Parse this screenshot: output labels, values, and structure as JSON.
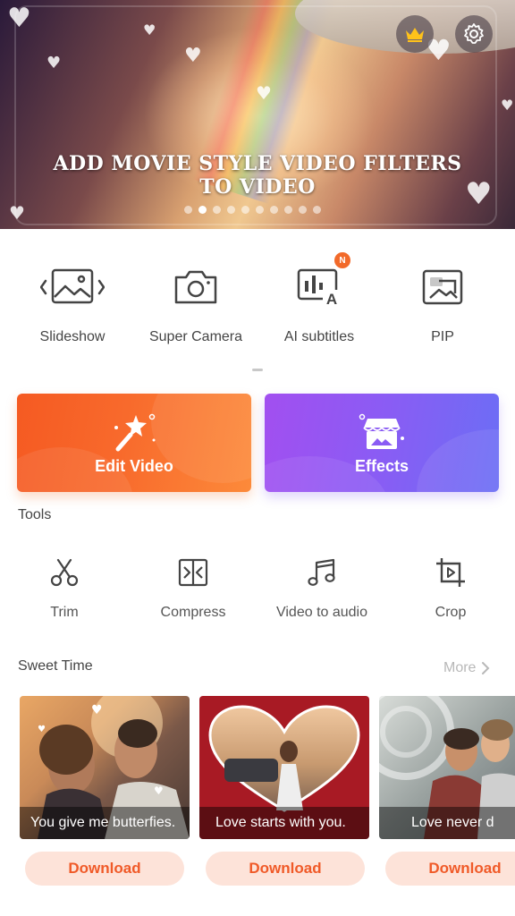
{
  "banner": {
    "title_line1": "ADD MOVIE STYLE VIDEO FILTERS",
    "title_line2": "TO VIDEO",
    "dots": 10,
    "active_dot": 1
  },
  "features": [
    {
      "label": "Slideshow",
      "icon": "slideshow-icon"
    },
    {
      "label": "Super Camera",
      "icon": "camera-icon"
    },
    {
      "label": "AI subtitles",
      "icon": "ai-subtitles-icon",
      "badge": "N"
    },
    {
      "label": "PIP",
      "icon": "pip-icon"
    }
  ],
  "cards": {
    "edit_video": "Edit Video",
    "effects": "Effects"
  },
  "tools_section": {
    "title": "Tools",
    "items": [
      {
        "label": "Trim",
        "icon": "scissors-icon"
      },
      {
        "label": "Compress",
        "icon": "compress-icon"
      },
      {
        "label": "Video to audio",
        "icon": "music-note-icon"
      },
      {
        "label": "Crop",
        "icon": "crop-icon"
      }
    ]
  },
  "sweet_time": {
    "title": "Sweet Time",
    "more_label": "More",
    "templates": [
      {
        "caption": "You give me butterfies.",
        "download_label": "Download"
      },
      {
        "caption": "Love starts with you.",
        "download_label": "Download"
      },
      {
        "caption": "Love never d",
        "download_label": "Download"
      }
    ]
  },
  "colors": {
    "accent": "#f26a2a",
    "edit_card": "#f86a2c",
    "effects_card": "#8a5cf4",
    "download_bg": "#fde3d9"
  }
}
